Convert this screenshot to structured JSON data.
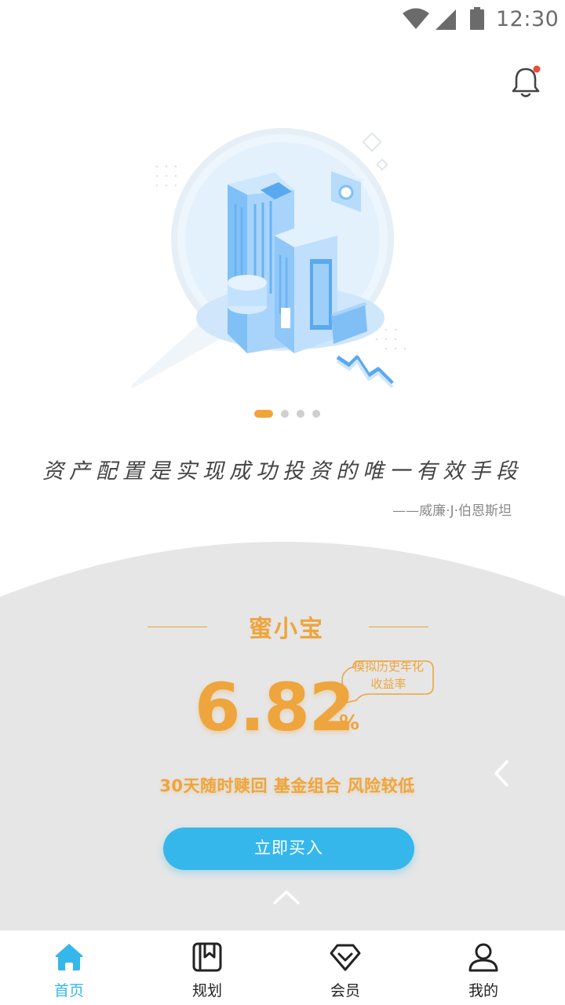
{
  "status_bar": {
    "time": "12:30"
  },
  "hero": {
    "page_count": 4,
    "active_index": 0
  },
  "quote": {
    "text": "资产配置是实现成功投资的唯一有效手段",
    "author": "——威廉·J·伯恩斯坦"
  },
  "product": {
    "name": "蜜小宝",
    "rate": "6.82",
    "rate_unit": "%",
    "rate_label_line1": "模拟历史年化",
    "rate_label_line2": "收益率",
    "features": "30天随时赎回 基金组合 风险较低",
    "buy_label": "立即买入"
  },
  "tabs": [
    {
      "label": "首页",
      "icon": "home-icon",
      "active": true
    },
    {
      "label": "规划",
      "icon": "book-icon",
      "active": false
    },
    {
      "label": "会员",
      "icon": "diamond-icon",
      "active": false
    },
    {
      "label": "我的",
      "icon": "user-icon",
      "active": false
    }
  ],
  "colors": {
    "accent_orange": "#eea53d",
    "accent_blue": "#35b7ec",
    "notification_dot": "#f04b3a"
  }
}
